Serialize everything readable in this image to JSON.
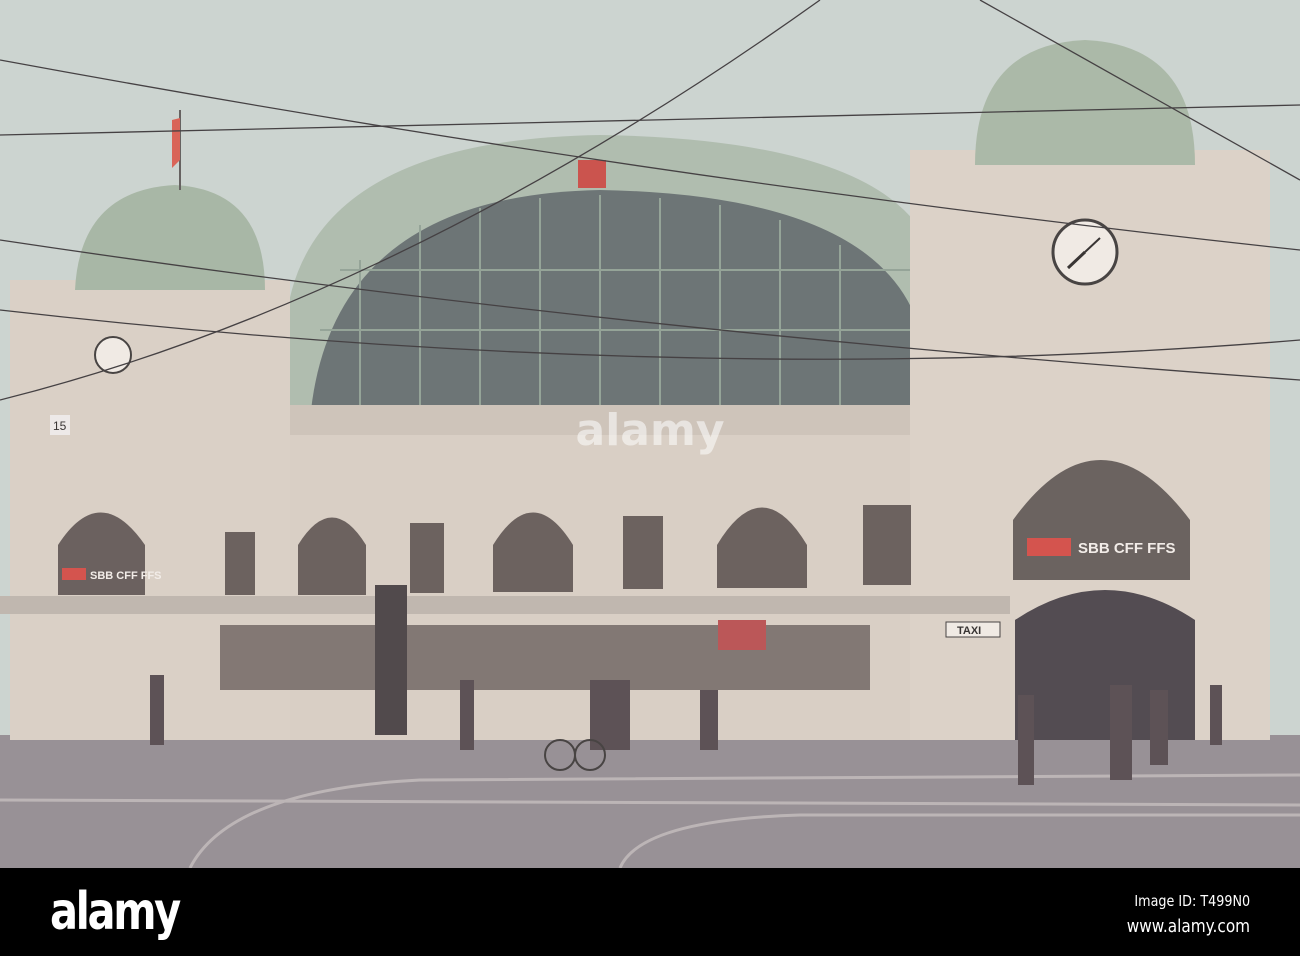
{
  "photo": {
    "signs": {
      "sbb_left": "SBB CFF FFS",
      "sbb_right": "SBB CFF FFS",
      "taxi": "TAXI",
      "platform_number": "15"
    },
    "watermark": "alamy"
  },
  "footer": {
    "logo": "alamy",
    "image_id": "Image ID: T499N0",
    "url": "www.alamy.com"
  },
  "colors": {
    "sky": "#c9d6d3",
    "stone": "#d9d2c8",
    "dome": "#9fb5a2",
    "ground": "#8f8b92",
    "sbb_red": "#d2453f"
  }
}
